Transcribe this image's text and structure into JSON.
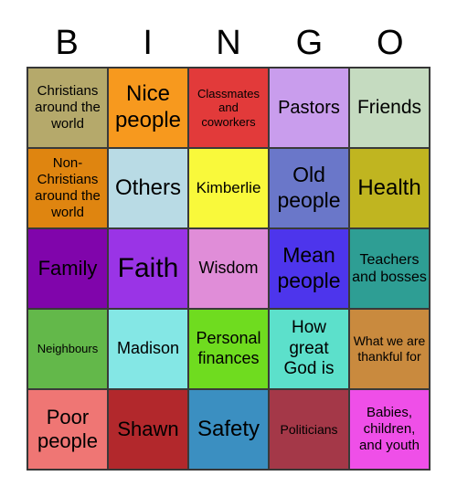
{
  "title_letters": [
    "B",
    "I",
    "N",
    "G",
    "O"
  ],
  "cells": [
    {
      "label": "Christians around the world",
      "color": "#b5a96b",
      "size": 15
    },
    {
      "label": "Nice people",
      "color": "#f7991e",
      "size": 24
    },
    {
      "label": "Classmates and coworkers",
      "color": "#e23a3a",
      "size": 13
    },
    {
      "label": "Pastors",
      "color": "#c99ded",
      "size": 20
    },
    {
      "label": "Friends",
      "color": "#c5dbc0",
      "size": 21
    },
    {
      "label": "Non-Christians around the world",
      "color": "#df8510",
      "size": 15
    },
    {
      "label": "Others",
      "color": "#b9dbe5",
      "size": 24
    },
    {
      "label": "Kimberlie",
      "color": "#f9f93b",
      "size": 17
    },
    {
      "label": "Old people",
      "color": "#6a77c9",
      "size": 23
    },
    {
      "label": "Health",
      "color": "#c0b520",
      "size": 24
    },
    {
      "label": "Family",
      "color": "#8005ab",
      "size": 22
    },
    {
      "label": "Faith",
      "color": "#9a34e6",
      "size": 30
    },
    {
      "label": "Wisdom",
      "color": "#e08dd8",
      "size": 18
    },
    {
      "label": "Mean people",
      "color": "#4d35ec",
      "size": 23
    },
    {
      "label": "Teachers and bosses",
      "color": "#2e9e94",
      "size": 16
    },
    {
      "label": "Neighbours",
      "color": "#63b84a",
      "size": 13
    },
    {
      "label": "Madison",
      "color": "#84e7e5",
      "size": 18
    },
    {
      "label": "Personal finances",
      "color": "#6fdc1f",
      "size": 18
    },
    {
      "label": "How great God is",
      "color": "#5ce0cb",
      "size": 19
    },
    {
      "label": "What we are thankful for",
      "color": "#c98a3e",
      "size": 14
    },
    {
      "label": "Poor people",
      "color": "#ef7674",
      "size": 22
    },
    {
      "label": "Shawn",
      "color": "#b2282c",
      "size": 22
    },
    {
      "label": "Safety",
      "color": "#3b8fc1",
      "size": 24
    },
    {
      "label": "Politicians",
      "color": "#a43848",
      "size": 14
    },
    {
      "label": "Babies, children, and youth",
      "color": "#ef4fe8",
      "size": 15
    }
  ]
}
